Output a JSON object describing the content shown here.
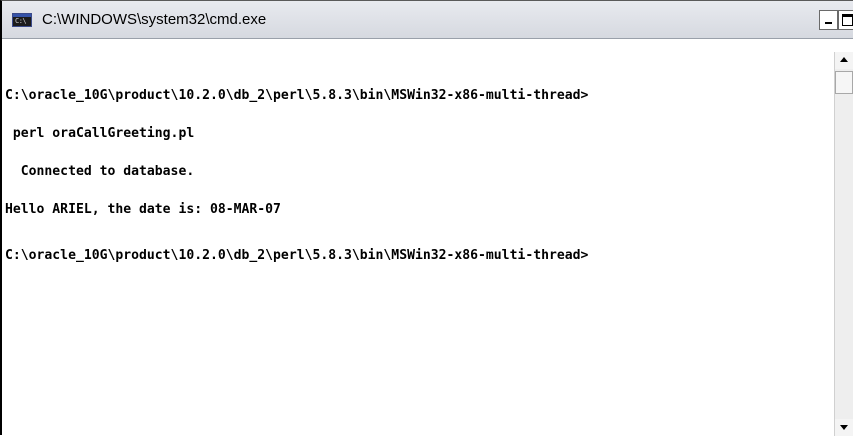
{
  "window": {
    "title": "C:\\WINDOWS\\system32\\cmd.exe",
    "icon": "cmd-console-icon",
    "icon_glyph": "C:\\",
    "controls": {
      "minimize": "minimize-icon",
      "maximize": "maximize-icon",
      "close": "close-icon",
      "close_glyph": "×"
    }
  },
  "console": {
    "lines": [
      "C:\\oracle_10G\\product\\10.2.0\\db_2\\perl\\5.8.3\\bin\\MSWin32-x86-multi-thread>",
      " perl oraCallGreeting.pl",
      "  Connected to database.",
      "Hello ARIEL, the date is: 08-MAR-07",
      "C:\\oracle_10G\\product\\10.2.0\\db_2\\perl\\5.8.3\\bin\\MSWin32-x86-multi-thread>"
    ]
  },
  "scrollbar": {
    "up_icon": "scroll-up-arrow-icon",
    "down_icon": "scroll-down-arrow-icon"
  },
  "colors": {
    "console_background": "#ffffff",
    "console_text": "#000000",
    "titlebar": "#dfe2e8"
  }
}
